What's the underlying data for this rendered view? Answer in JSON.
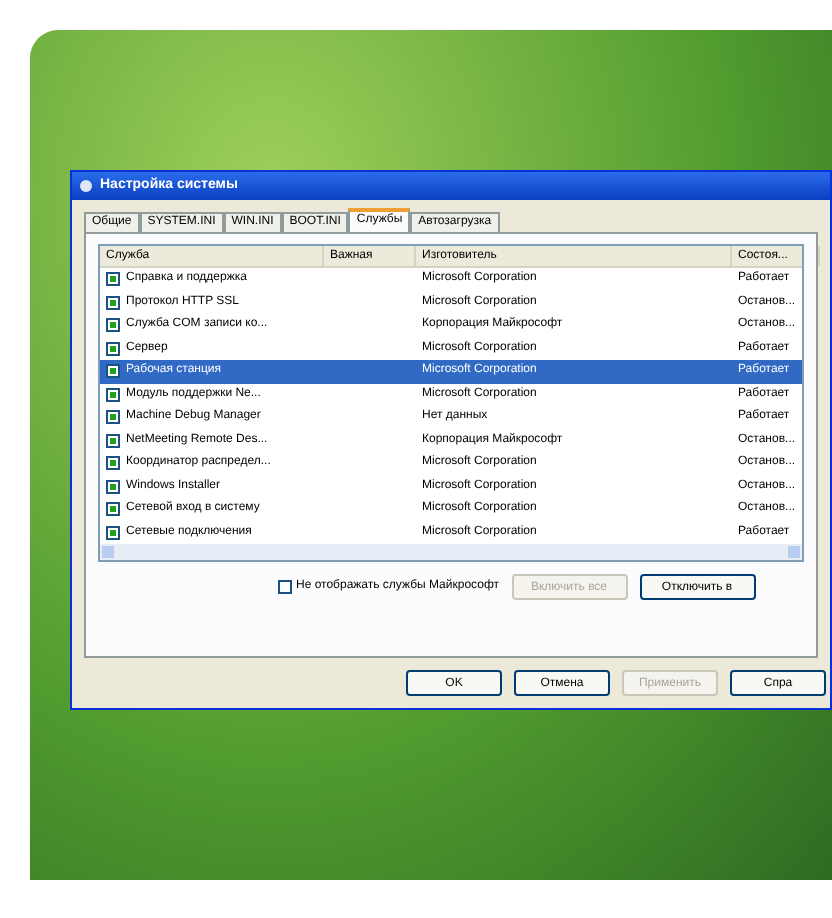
{
  "window": {
    "title": "Настройка системы"
  },
  "tabs": [
    {
      "label": "Общие",
      "selected": false
    },
    {
      "label": "SYSTEM.INI",
      "selected": false
    },
    {
      "label": "WIN.INI",
      "selected": false
    },
    {
      "label": "BOOT.INI",
      "selected": false
    },
    {
      "label": "Службы",
      "selected": true
    },
    {
      "label": "Автозагрузка",
      "selected": false
    }
  ],
  "table": {
    "columns": [
      "Служба",
      "Важная",
      "Изготовитель",
      "Состоя..."
    ],
    "rows": [
      {
        "cells": [
          "Справка и поддержка",
          "",
          "Microsoft Corporation",
          "Работает"
        ],
        "checked": true,
        "selected": false
      },
      {
        "cells": [
          "Протокол HTTP SSL",
          "",
          "Microsoft Corporation",
          "Останов..."
        ],
        "checked": true,
        "selected": false
      },
      {
        "cells": [
          "Служба COM записи ко...",
          "",
          "Корпорация Майкрософт",
          "Останов..."
        ],
        "checked": true,
        "selected": false
      },
      {
        "cells": [
          "Сервер",
          "",
          "Microsoft Corporation",
          "Работает"
        ],
        "checked": true,
        "selected": false
      },
      {
        "cells": [
          "Рабочая станция",
          "",
          "Microsoft Corporation",
          "Работает"
        ],
        "checked": true,
        "selected": true
      },
      {
        "cells": [
          "Модуль поддержки Ne...",
          "",
          "Microsoft Corporation",
          "Работает"
        ],
        "checked": true,
        "selected": false
      },
      {
        "cells": [
          "Machine Debug Manager",
          "",
          "Нет данных",
          "Работает"
        ],
        "checked": true,
        "selected": false
      },
      {
        "cells": [
          "NetMeeting Remote Des...",
          "",
          "Корпорация Майкрософт",
          "Останов..."
        ],
        "checked": true,
        "selected": false
      },
      {
        "cells": [
          "Координатор распредел...",
          "",
          "Microsoft Corporation",
          "Останов..."
        ],
        "checked": true,
        "selected": false
      },
      {
        "cells": [
          "Windows Installer",
          "",
          "Microsoft Corporation",
          "Останов..."
        ],
        "checked": true,
        "selected": false
      },
      {
        "cells": [
          "Сетевой вход в систему",
          "",
          "Microsoft Corporation",
          "Останов..."
        ],
        "checked": true,
        "selected": false
      },
      {
        "cells": [
          "Сетевые подключения",
          "",
          "Microsoft Corporation",
          "Работает"
        ],
        "checked": true,
        "selected": false
      }
    ]
  },
  "hide_microsoft": {
    "label": "Не отображать службы Майкрософт",
    "checked": false
  },
  "list_buttons": [
    {
      "label": "Включить все",
      "disabled": true
    },
    {
      "label": "Отключить в",
      "disabled": false
    }
  ],
  "buttons": [
    {
      "label": "OK",
      "disabled": false
    },
    {
      "label": "Отмена",
      "disabled": false
    },
    {
      "label": "Применить",
      "disabled": true
    },
    {
      "label": "Спра",
      "disabled": false
    }
  ]
}
